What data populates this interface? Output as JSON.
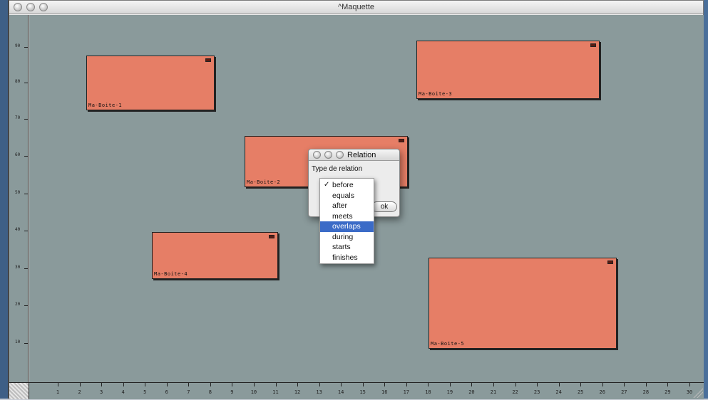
{
  "window": {
    "title": "^Maquette"
  },
  "colors": {
    "canvas": "#8a9a9b",
    "box_fill": "#e67e66",
    "menu_highlight": "#3b6bc7"
  },
  "y_ruler": {
    "ticks": [
      "10",
      "20",
      "30",
      "40",
      "50",
      "60",
      "70",
      "80",
      "90"
    ]
  },
  "x_ruler": {
    "ticks": [
      "1",
      "2",
      "3",
      "4",
      "5",
      "6",
      "7",
      "8",
      "9",
      "10",
      "11",
      "12",
      "13",
      "14",
      "15",
      "16",
      "17",
      "18",
      "19",
      "20",
      "21",
      "22",
      "23",
      "24",
      "25",
      "26",
      "27",
      "28",
      "29",
      "30"
    ]
  },
  "boxes": [
    {
      "label": "Ma-Boite-1"
    },
    {
      "label": "Ma-Boite-2"
    },
    {
      "label": "Ma-Boite-3"
    },
    {
      "label": "Ma-Boite-4"
    },
    {
      "label": "Ma-Boite-5"
    }
  ],
  "dialog": {
    "title": "Relation",
    "label": "Type de relation",
    "ok_label": "ok"
  },
  "popup_menu": {
    "checked_index": 0,
    "highlighted_index": 4,
    "items": [
      "before",
      "equals",
      "after",
      "meets",
      "overlaps",
      "during",
      "starts",
      "finishes"
    ]
  }
}
